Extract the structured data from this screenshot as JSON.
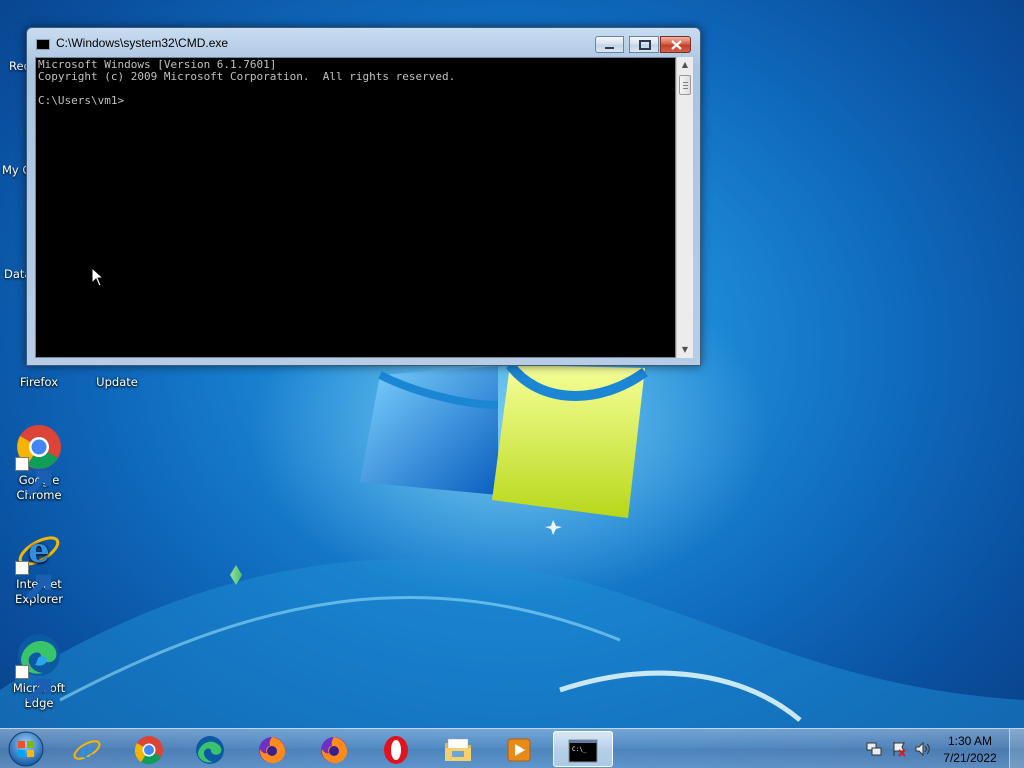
{
  "desktop": {
    "partial_labels": [
      "Rec",
      "My C",
      "Data"
    ],
    "icons": [
      {
        "label": "Firefox",
        "icon": "firefox-icon"
      },
      {
        "label": "Update",
        "icon": "update-icon"
      },
      {
        "label": "Google Chrome",
        "icon": "chrome-icon"
      },
      {
        "label": "Internet Explorer",
        "icon": "internet-explorer-icon"
      },
      {
        "label": "Microsoft Edge",
        "icon": "edge-icon"
      }
    ]
  },
  "cmd_window": {
    "title": "C:\\Windows\\system32\\CMD.exe",
    "lines": [
      "Microsoft Windows [Version 6.1.7601]",
      "Copyright (c) 2009 Microsoft Corporation.  All rights reserved.",
      "",
      "C:\\Users\\vm1>"
    ]
  },
  "taskbar": {
    "items": [
      "start-orb-icon",
      "internet-explorer-icon",
      "chrome-icon",
      "edge-icon",
      "firefox-icon",
      "firefox-icon",
      "opera-icon",
      "file-explorer-icon",
      "media-player-icon",
      "cmd-icon"
    ],
    "active_item": "cmd-icon",
    "cmd_icon_text": "C:\\_"
  },
  "tray": {
    "icons": [
      "network-icon",
      "action-center-icon",
      "volume-icon"
    ],
    "time": "1:30 AM",
    "date": "7/21/2022"
  },
  "colors": {
    "console_bg": "#000000",
    "console_fg": "#c0c0c0",
    "close_button": "#c4402a",
    "desktop_bg": "#1b86d4"
  }
}
